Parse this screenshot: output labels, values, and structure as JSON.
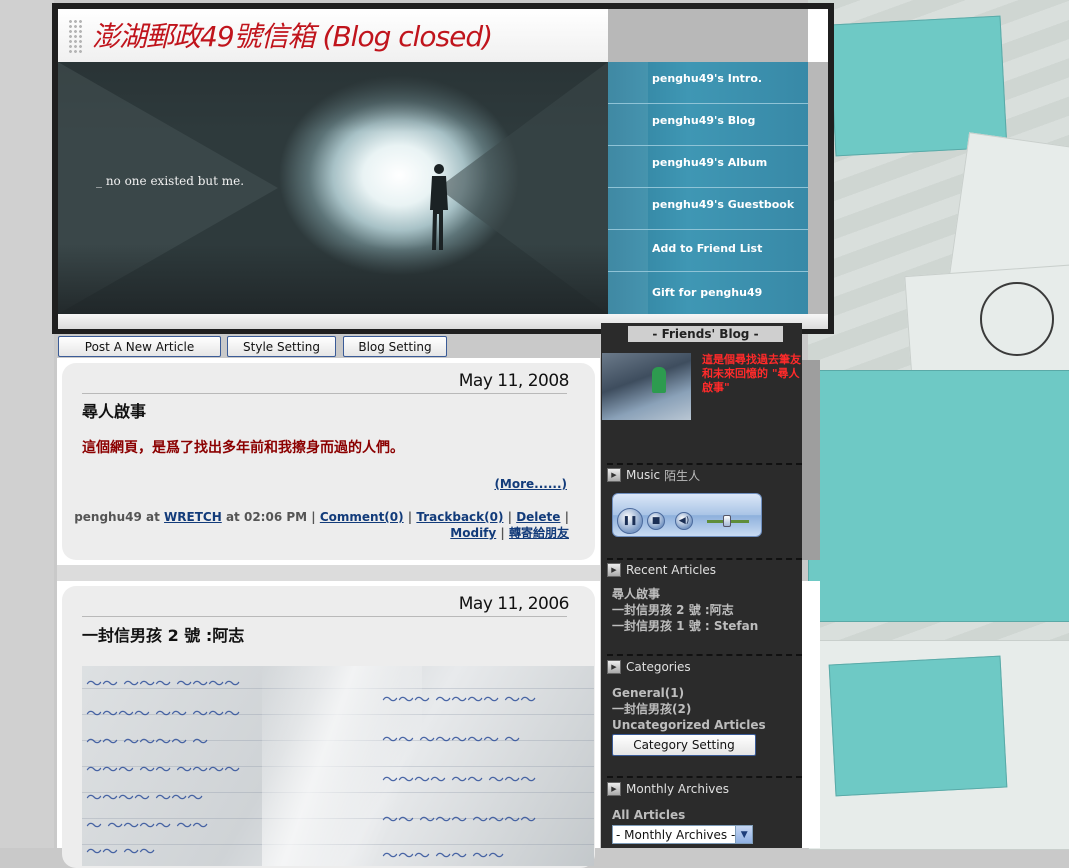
{
  "blog": {
    "title": "澎湖郵政49號信箱 (Blog closed)",
    "tagline": "_ no one existed but me."
  },
  "nav": {
    "items": [
      {
        "label": "penghu49's Intro."
      },
      {
        "label": "penghu49's Blog"
      },
      {
        "label": "penghu49's Album"
      },
      {
        "label": "penghu49's Guestbook"
      },
      {
        "label": "Add to Friend List"
      },
      {
        "label": "Gift for penghu49"
      }
    ]
  },
  "toolbar": {
    "post_article": "Post A New Article",
    "style_setting": "Style Setting",
    "blog_setting": "Blog Setting"
  },
  "posts": [
    {
      "date": "May 11, 2008",
      "title": "尋人啟事",
      "body": "這個網頁，是爲了找出多年前和我擦身而過的人們。",
      "more": "(More......)",
      "meta_author": "penghu49 at",
      "meta_site": "WRETCH",
      "meta_time": "at 02:06 PM |",
      "comment": "Comment(0)",
      "trackback": "Trackback(0)",
      "delete": "Delete",
      "modify": "Modify",
      "forward": "轉寄給朋友"
    },
    {
      "date": "May 11, 2006",
      "title": "一封信男孩 2 號 :阿志"
    }
  ],
  "sidebar": {
    "friends_title": "- Friends' Blog -",
    "friend_desc": "這是個尋找過去筆友和未來回憶的 \"尋人啟事\"",
    "music_title": "Music",
    "music_song": "陌生人",
    "recent_title": "Recent Articles",
    "recent": [
      "尋人啟事",
      "一封信男孩 2 號 :阿志",
      "一封信男孩 1 號 : Stefan"
    ],
    "categories_title": "Categories",
    "categories": [
      "General(1)",
      "一封信男孩(2)",
      "Uncategorized Articles"
    ],
    "category_setting": "Category Setting",
    "archives_title": "Monthly Archives",
    "all_articles": "All Articles",
    "archive_select": "- Monthly Archives -"
  },
  "colors": {
    "title_red": "#c0141c",
    "nav_teal": "#3889a7",
    "post_body_red": "#8b0000",
    "friend_desc_red": "#ff2a2a",
    "link_blue": "#123b7a",
    "sidebar_bg": "#2b2b2b"
  },
  "icons": {
    "section_icon": "play-arrow-icon",
    "player_pause": "pause-icon",
    "player_stop": "stop-icon",
    "player_volume": "volume-icon"
  }
}
